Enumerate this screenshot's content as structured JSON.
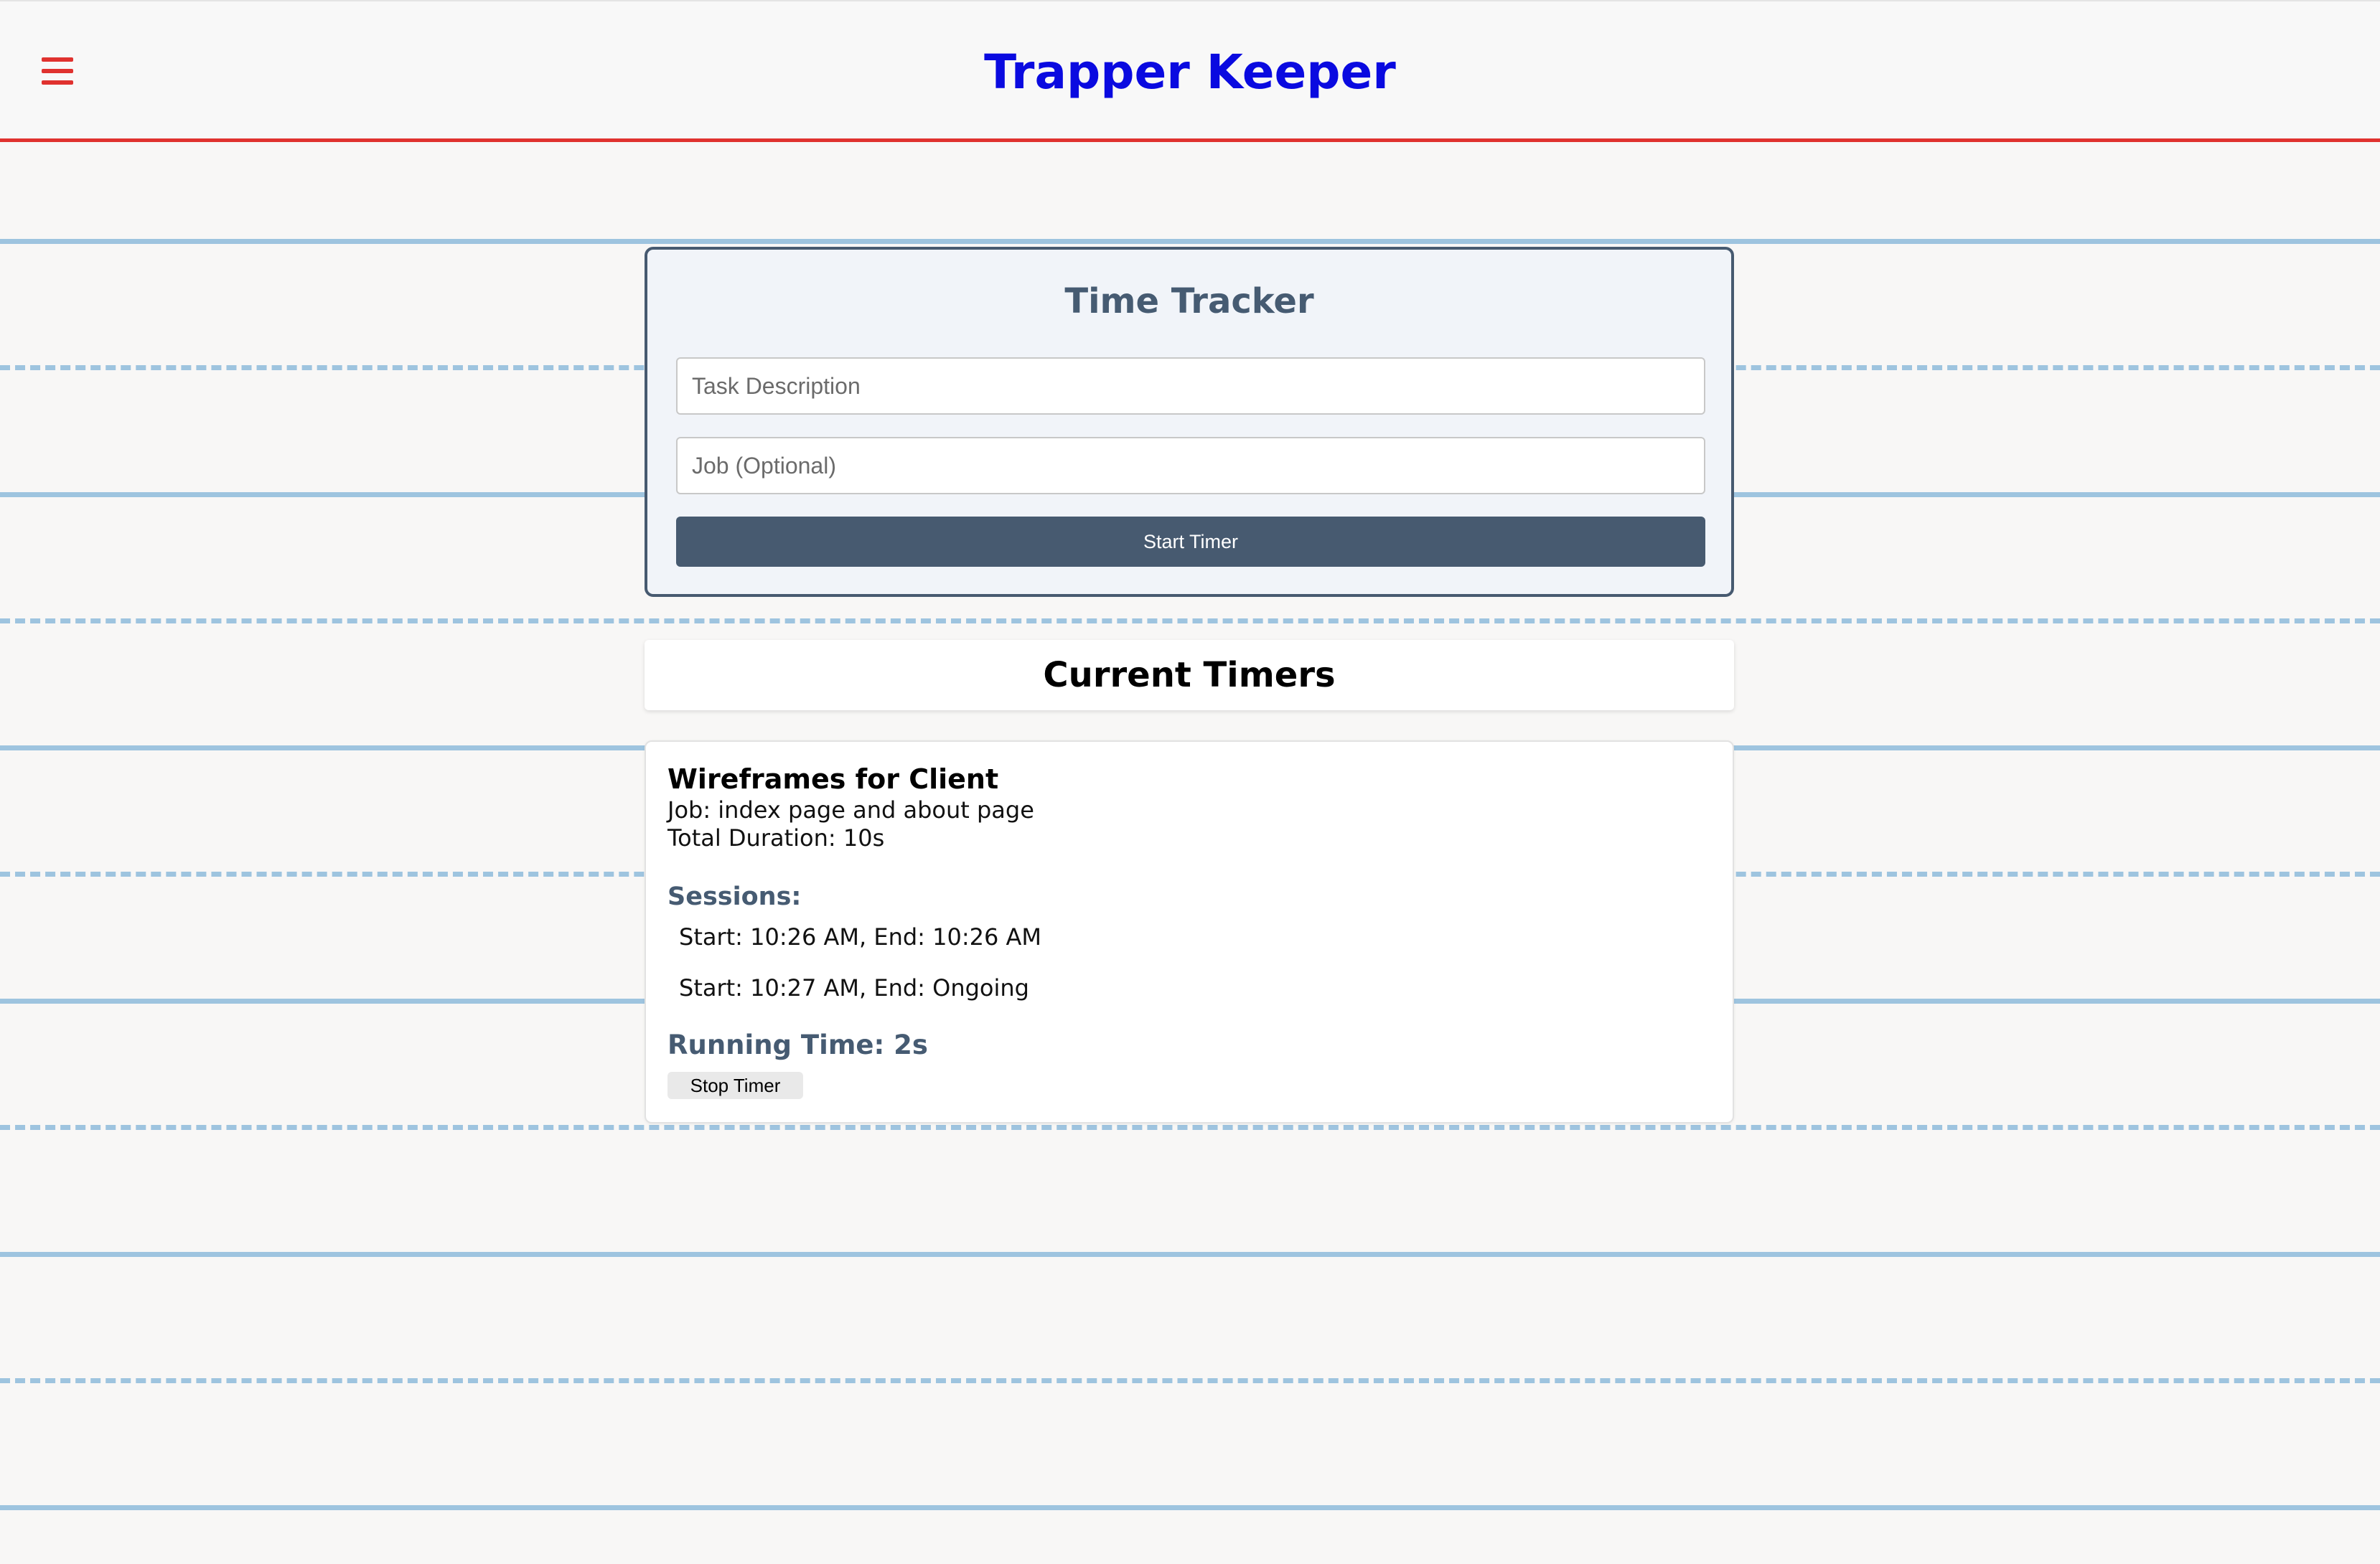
{
  "header": {
    "title": "Trapper Keeper",
    "menu_icon": "hamburger-menu-icon",
    "accent_color": "#e0322f",
    "title_color": "#0a0ae0"
  },
  "tracker": {
    "title": "Time Tracker",
    "task_placeholder": "Task Description",
    "task_value": "",
    "job_placeholder": "Job (Optional)",
    "job_value": "",
    "start_button_label": "Start Timer",
    "primary_color": "#475a70"
  },
  "current_timers": {
    "title": "Current Timers",
    "timers": [
      {
        "name": "Wireframes for Client",
        "job": "Job: index page and about page",
        "total_duration": "Total Duration: 10s",
        "sessions_heading": "Sessions:",
        "sessions": [
          "Start: 10:26 AM, End: 10:26 AM",
          "Start: 10:27 AM, End: Ongoing"
        ],
        "running_time": "Running Time: 2s",
        "stop_button_label": "Stop Timer"
      }
    ]
  },
  "background": {
    "rule_color": "#9ec4df",
    "paper_color": "#f8f7f6"
  }
}
